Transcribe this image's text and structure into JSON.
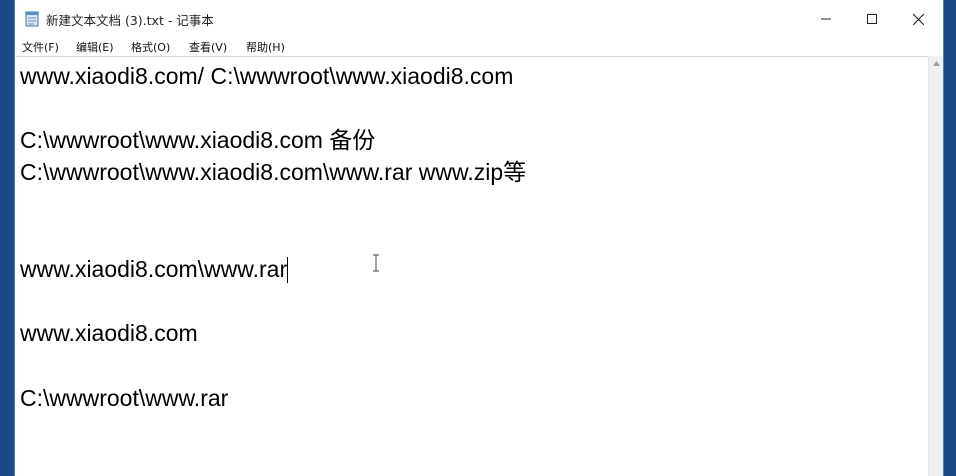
{
  "window": {
    "title": "新建文本文档 (3).txt - 记事本",
    "icon": "notepad-icon"
  },
  "caption_buttons": {
    "minimize_icon": "minimize-icon",
    "maximize_icon": "maximize-icon",
    "close_icon": "close-icon"
  },
  "menu": {
    "items": [
      {
        "label": "文件(F)"
      },
      {
        "label": "编辑(E)"
      },
      {
        "label": "格式(O)"
      },
      {
        "label": "查看(V)"
      },
      {
        "label": "帮助(H)"
      }
    ]
  },
  "editor": {
    "lines": [
      "www.xiaodi8.com/ C:\\wwwroot\\www.xiaodi8.com",
      "C:\\wwwroot\\www.xiaodi8.com 备份",
      "C:\\wwwroot\\www.xiaodi8.com\\www.rar www.zip等",
      "www.xiaodi8.com\\www.rar",
      "www.xiaodi8.com",
      "C:\\wwwroot\\www.rar"
    ]
  },
  "colors": {
    "background": "#1a4a86",
    "window": "#ffffff",
    "text": "#000000"
  }
}
